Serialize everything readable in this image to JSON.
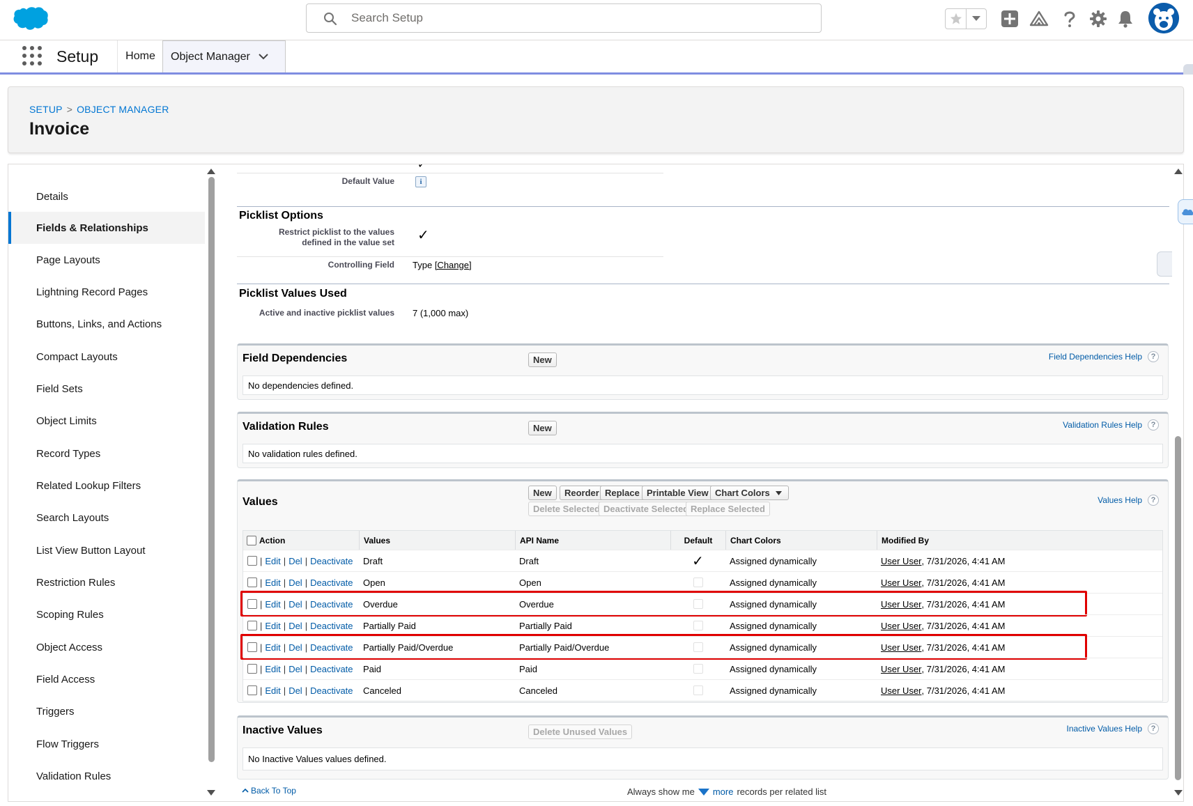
{
  "colors": {
    "brand": "#0176d3",
    "link": "#015ba7",
    "highlight": "#e00000",
    "nav_underline": "#7f8de1"
  },
  "header": {
    "search_placeholder": "Search Setup",
    "icons": [
      "favorites-star-icon",
      "favorites-dropdown-icon",
      "add-icon",
      "trailhead-icon",
      "help-icon",
      "gear-icon",
      "bell-icon",
      "avatar"
    ]
  },
  "app_nav": {
    "app_name": "Setup",
    "tabs": [
      {
        "label": "Home"
      },
      {
        "label": "Object Manager"
      }
    ]
  },
  "object_header": {
    "breadcrumb": [
      "SETUP",
      "OBJECT MANAGER"
    ],
    "breadcrumb_sep": ">",
    "title": "Invoice"
  },
  "left_nav": {
    "active": "Fields & Relationships",
    "items": [
      "Details",
      "Fields & Relationships",
      "Page Layouts",
      "Lightning Record Pages",
      "Buttons, Links, and Actions",
      "Compact Layouts",
      "Field Sets",
      "Object Limits",
      "Record Types",
      "Related Lookup Filters",
      "Search Layouts",
      "List View Button Layout",
      "Restriction Rules",
      "Scoping Rules",
      "Object Access",
      "Field Access",
      "Triggers",
      "Flow Triggers",
      "Validation Rules"
    ]
  },
  "detail": {
    "default_value_label": "Default Value",
    "info_glyph": "i",
    "picklist_options": {
      "title": "Picklist Options",
      "restrict_label_1": "Restrict picklist to the values",
      "restrict_label_2": "defined in the value set",
      "restrict_checked": true,
      "controlling_label": "Controlling Field",
      "controlling_value": "Type",
      "change_link": "[Change]"
    },
    "picklist_values_used": {
      "title": "Picklist Values Used",
      "label": "Active and inactive picklist values",
      "value": "7 (1,000 max)"
    }
  },
  "field_dependencies": {
    "title": "Field Dependencies",
    "new_button": "New",
    "help": "Field Dependencies Help",
    "empty": "No dependencies defined."
  },
  "validation_rules": {
    "title": "Validation Rules",
    "new_button": "New",
    "help": "Validation Rules Help",
    "empty": "No validation rules defined."
  },
  "values": {
    "title": "Values",
    "help": "Values Help",
    "buttons": {
      "new": "New",
      "reorder": "Reorder",
      "replace": "Replace",
      "printable": "Printable View",
      "chart_colors": "Chart Colors"
    },
    "disabled_buttons": {
      "delete_selected": "Delete Selected",
      "deactivate_selected": "Deactivate Selected",
      "replace_selected": "Replace Selected"
    },
    "columns": [
      "Action",
      "Values",
      "API Name",
      "Default",
      "Chart Colors",
      "Modified By"
    ],
    "action_links": {
      "edit": "Edit",
      "del": "Del",
      "deactivate": "Deactivate",
      "pipe": "|"
    },
    "rows": [
      {
        "value": "Draft",
        "api": "Draft",
        "default": true,
        "chart": "Assigned dynamically",
        "user": "User User",
        "date": ", 7/31/2026, 4:41 AM",
        "highlighted": false
      },
      {
        "value": "Open",
        "api": "Open",
        "default": false,
        "chart": "Assigned dynamically",
        "user": "User User",
        "date": ", 7/31/2026, 4:41 AM",
        "highlighted": false
      },
      {
        "value": "Overdue",
        "api": "Overdue",
        "default": false,
        "chart": "Assigned dynamically",
        "user": "User User",
        "date": ", 7/31/2026, 4:41 AM",
        "highlighted": true
      },
      {
        "value": "Partially Paid",
        "api": "Partially Paid",
        "default": false,
        "chart": "Assigned dynamically",
        "user": "User User",
        "date": ", 7/31/2026, 4:41 AM",
        "highlighted": false
      },
      {
        "value": "Partially Paid/Overdue",
        "api": "Partially Paid/Overdue",
        "default": false,
        "chart": "Assigned dynamically",
        "user": "User User",
        "date": ", 7/31/2026, 4:41 AM",
        "highlighted": true
      },
      {
        "value": "Paid",
        "api": "Paid",
        "default": false,
        "chart": "Assigned dynamically",
        "user": "User User",
        "date": ", 7/31/2026, 4:41 AM",
        "highlighted": false
      },
      {
        "value": "Canceled",
        "api": "Canceled",
        "default": false,
        "chart": "Assigned dynamically",
        "user": "User User",
        "date": ", 7/31/2026, 4:41 AM",
        "highlighted": false
      }
    ]
  },
  "inactive_values": {
    "title": "Inactive Values",
    "delete_unused": "Delete Unused Values",
    "help": "Inactive Values Help",
    "empty": "No Inactive Values values defined."
  },
  "footer": {
    "back_to_top": "Back To Top",
    "always_show_prefix": "Always show me",
    "more": "more",
    "always_show_suffix": "records per related list"
  },
  "glyphs": {
    "check": "✓",
    "help": "?"
  }
}
